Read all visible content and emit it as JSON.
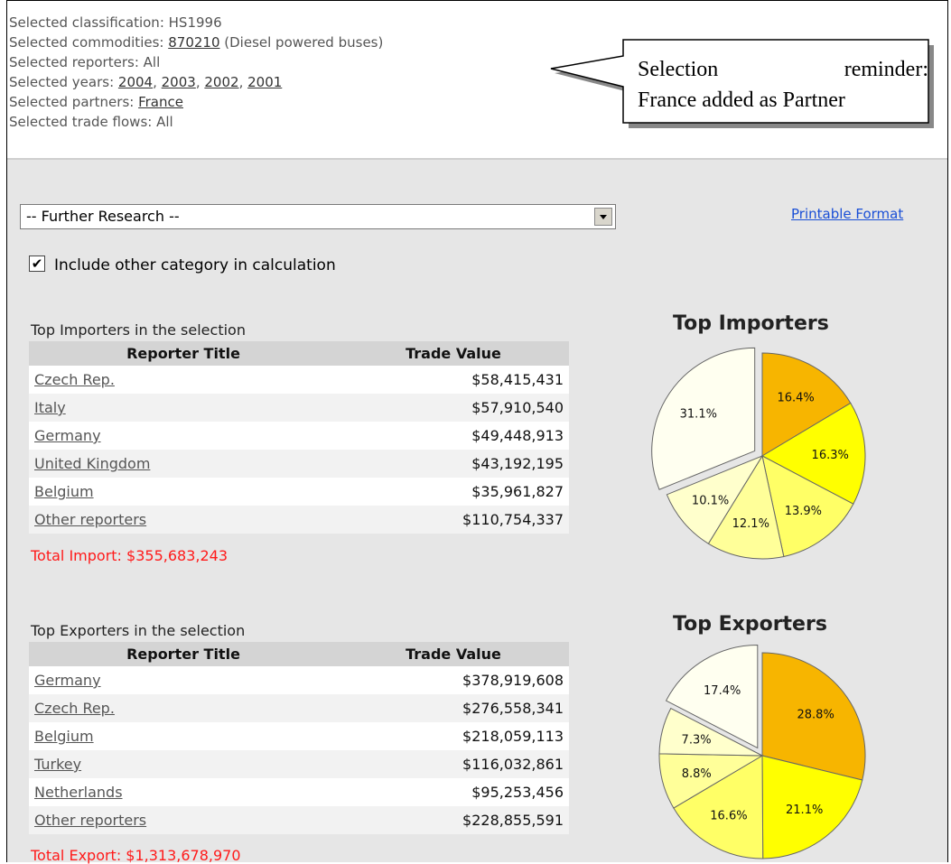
{
  "selection": {
    "classification_label": "Selected classification: ",
    "classification": "HS1996",
    "commodities_label": "Selected commodities: ",
    "commodity_code": "870210",
    "commodity_desc": " (Diesel powered buses)",
    "reporters_label": "Selected reporters: ",
    "reporters": "All",
    "years_label": "Selected years: ",
    "years": [
      "2004",
      "2003",
      "2002",
      "2001"
    ],
    "partners_label": "Selected partners: ",
    "partner": "France",
    "flows_label": "Selected trade flows: ",
    "flows": "All"
  },
  "callout": {
    "line1_a": "Selection",
    "line1_b": "reminder:",
    "line2": "France added as Partner"
  },
  "toolbar": {
    "research_select": "-- Further Research --",
    "printable_link": "Printable Format",
    "include_other_label": "Include other category in calculation",
    "include_other_checked": true
  },
  "importers": {
    "caption": "Top Importers in the selection",
    "col_reporter": "Reporter Title",
    "col_value": "Trade Value",
    "rows": [
      {
        "name": "Czech Rep.",
        "value": "$58,415,431"
      },
      {
        "name": "Italy",
        "value": "$57,910,540"
      },
      {
        "name": "Germany",
        "value": "$49,448,913"
      },
      {
        "name": "United Kingdom",
        "value": "$43,192,195"
      },
      {
        "name": "Belgium",
        "value": "$35,961,827"
      },
      {
        "name": "Other reporters",
        "value": "$110,754,337"
      }
    ],
    "total": "Total Import: $355,683,243"
  },
  "exporters": {
    "caption": "Top Exporters in the selection",
    "col_reporter": "Reporter Title",
    "col_value": "Trade Value",
    "rows": [
      {
        "name": "Germany",
        "value": "$378,919,608"
      },
      {
        "name": "Czech Rep.",
        "value": "$276,558,341"
      },
      {
        "name": "Belgium",
        "value": "$218,059,113"
      },
      {
        "name": "Turkey",
        "value": "$116,032,861"
      },
      {
        "name": "Netherlands",
        "value": "$95,253,456"
      },
      {
        "name": "Other reporters",
        "value": "$228,855,591"
      }
    ],
    "total": "Total Export: $1,313,678,970"
  },
  "chart_data": [
    {
      "type": "pie",
      "title": "Top Importers",
      "slices": [
        {
          "label": "16.4%",
          "value": 16.4,
          "color": "#f7b500"
        },
        {
          "label": "16.3%",
          "value": 16.3,
          "color": "#ffff00"
        },
        {
          "label": "13.9%",
          "value": 13.9,
          "color": "#ffff66"
        },
        {
          "label": "12.1%",
          "value": 12.1,
          "color": "#ffff99"
        },
        {
          "label": "10.1%",
          "value": 10.1,
          "color": "#ffffcc"
        },
        {
          "label": "31.1%",
          "value": 31.1,
          "color": "#fffff0",
          "exploded": true
        }
      ]
    },
    {
      "type": "pie",
      "title": "Top Exporters",
      "slices": [
        {
          "label": "28.8%",
          "value": 28.8,
          "color": "#f7b500"
        },
        {
          "label": "21.1%",
          "value": 21.1,
          "color": "#ffff00"
        },
        {
          "label": "16.6%",
          "value": 16.6,
          "color": "#ffff66"
        },
        {
          "label": "8.8%",
          "value": 8.8,
          "color": "#ffff99"
        },
        {
          "label": "7.3%",
          "value": 7.3,
          "color": "#ffffcc"
        },
        {
          "label": "17.4%",
          "value": 17.4,
          "color": "#fffff0",
          "exploded": true
        }
      ]
    }
  ]
}
